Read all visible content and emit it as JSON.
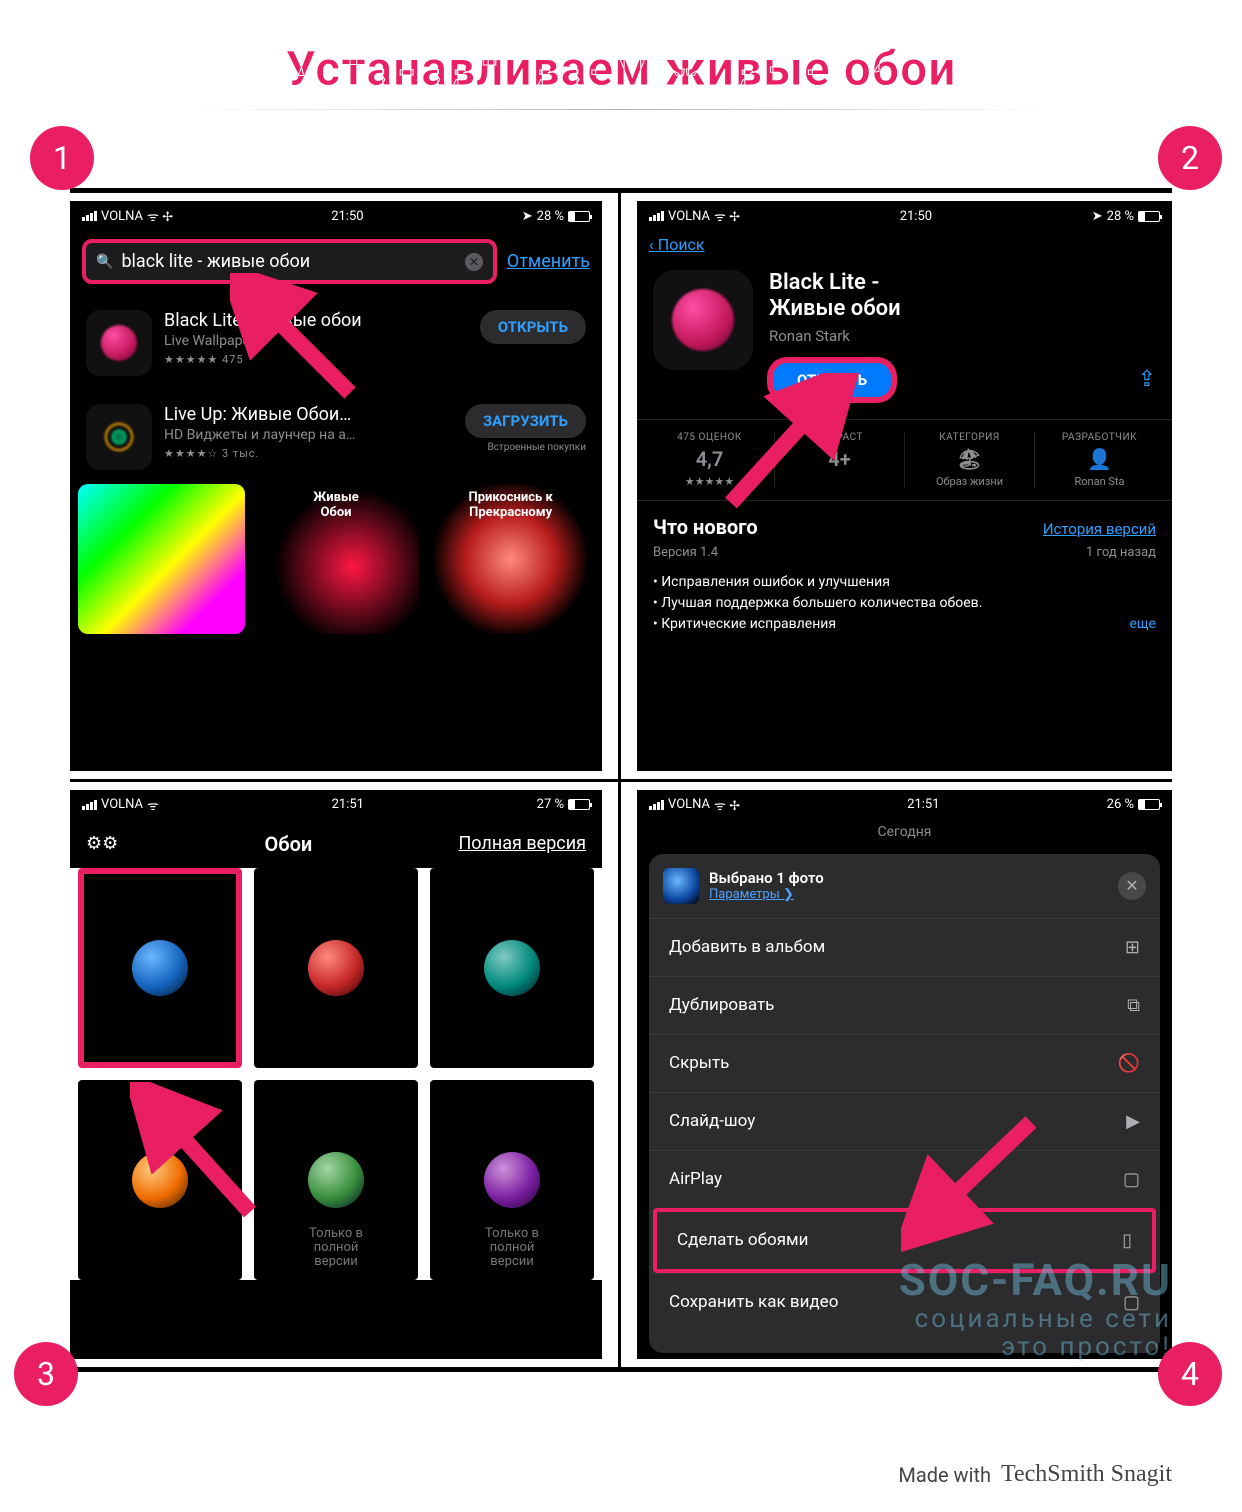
{
  "title": "Устанавливаем живые обои",
  "badges": {
    "1": "1",
    "2": "2",
    "3": "3",
    "4": "4"
  },
  "footer": {
    "made": "Made with",
    "brand": "TechSmith Snagit"
  },
  "watermark": {
    "line1": "SOC-FAQ.RU",
    "line2": "социальные сети",
    "line3": "это просто!"
  },
  "s1": {
    "status": {
      "carrier": "VOLNA",
      "time": "21:50",
      "battery": "28 %"
    },
    "search": {
      "query": "black lite - живые обои",
      "cancel": "Отменить"
    },
    "r1": {
      "name": "Black Lite - Живые обои",
      "sub": "Live Wallpapers",
      "stars": "★★★★★",
      "count": "475",
      "btn": "ОТКРЫТЬ"
    },
    "r2": {
      "name": "Live Up: Живые Обои…",
      "sub": "HD Виджеты и лаунчер на а…",
      "stars": "★★★★☆",
      "count": "3 тыс.",
      "btn": "ЗАГРУЗИТЬ",
      "iap": "Встроенные покупки"
    },
    "shots": {
      "s2": "Живые\nОбои",
      "s3": "Прикоснись к\nПрекрасному"
    }
  },
  "s2": {
    "status": {
      "carrier": "VOLNA",
      "time": "21:50",
      "battery": "28 %"
    },
    "back": "Поиск",
    "app": {
      "name": "Black Lite -\nЖивые обои",
      "pub": "Ronan Stark",
      "open": "ОТКРЫТЬ"
    },
    "info": {
      "c1l": "475 ОЦЕНОК",
      "c1v": "4,7",
      "c1s": "★★★★★",
      "c2l": "ВОЗРАСТ",
      "c2v": "4+",
      "c3l": "КАТЕГОРИЯ",
      "c3s": "Образ жизни",
      "c4l": "РАЗРАБОТЧИК",
      "c4s": "Ronan Sta"
    },
    "wn": {
      "title": "Что нового",
      "history": "История версий",
      "ver": "Версия 1.4",
      "ago": "1 год назад",
      "b1": "• Исправления ошибок и улучшения",
      "b2": "• Лучшая поддержка большего количества обоев.",
      "b3": "• Критические исправления",
      "more": "еще"
    }
  },
  "s3": {
    "status": {
      "carrier": "VOLNA",
      "time": "21:51",
      "battery": "27 %"
    },
    "hdr": {
      "title": "Обои",
      "full": "Полная версия"
    },
    "lock": "Только в\nполной\nверсии"
  },
  "s4": {
    "status": {
      "carrier": "VOLNA",
      "time": "21:51",
      "battery": "26 %"
    },
    "today": "Сегодня",
    "hdr": {
      "sel": "Выбрано 1 фото",
      "params": "Параметры ❯"
    },
    "rows": {
      "r1": "Добавить в альбом",
      "r2": "Дублировать",
      "r3": "Скрыть",
      "r4": "Слайд-шоу",
      "r5": "AirPlay",
      "r6": "Сделать обоями",
      "r7": "Сохранить как видео"
    }
  }
}
